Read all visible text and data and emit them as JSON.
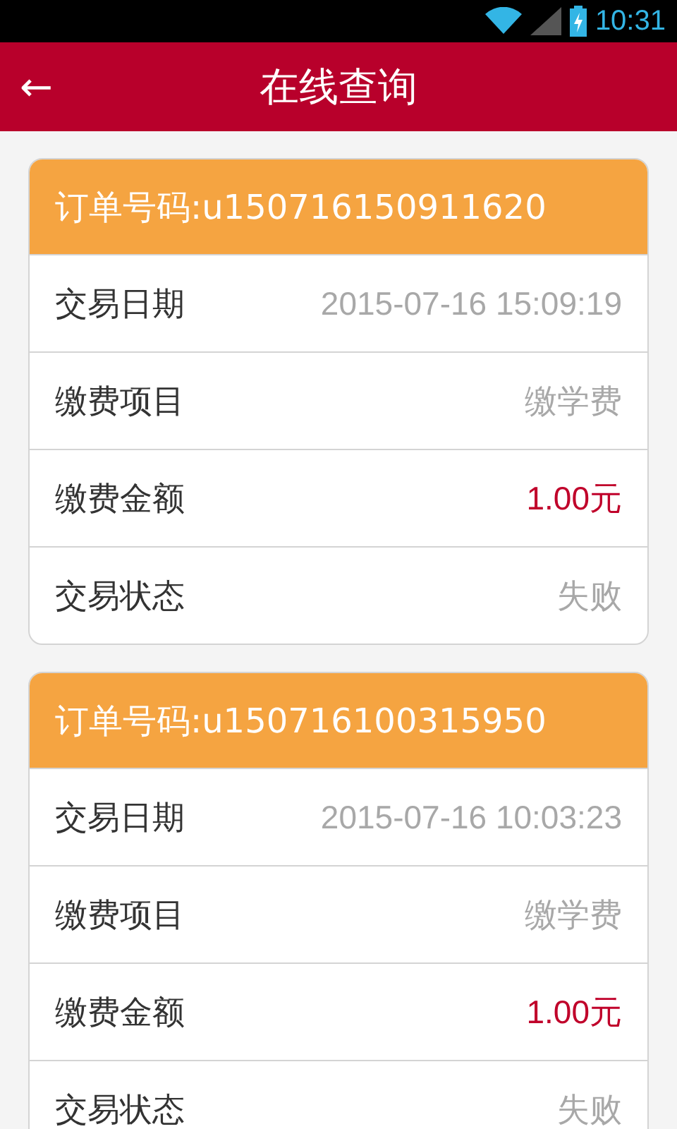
{
  "status_bar": {
    "time": "10:31"
  },
  "header": {
    "back": "←",
    "title": "在线查询"
  },
  "orders": [
    {
      "title": "订单号码:u150716150911620",
      "rows": [
        {
          "label": "交易日期",
          "value": "2015-07-16 15:09:19",
          "kind": "plain"
        },
        {
          "label": "缴费项目",
          "value": "缴学费",
          "kind": "plain"
        },
        {
          "label": "缴费金额",
          "value": "1.00元",
          "kind": "amount"
        },
        {
          "label": "交易状态",
          "value": "失败",
          "kind": "plain"
        }
      ]
    },
    {
      "title": "订单号码:u150716100315950",
      "rows": [
        {
          "label": "交易日期",
          "value": "2015-07-16 10:03:23",
          "kind": "plain"
        },
        {
          "label": "缴费项目",
          "value": "缴学费",
          "kind": "plain"
        },
        {
          "label": "缴费金额",
          "value": "1.00元",
          "kind": "amount"
        },
        {
          "label": "交易状态",
          "value": "失败",
          "kind": "plain"
        }
      ]
    }
  ]
}
